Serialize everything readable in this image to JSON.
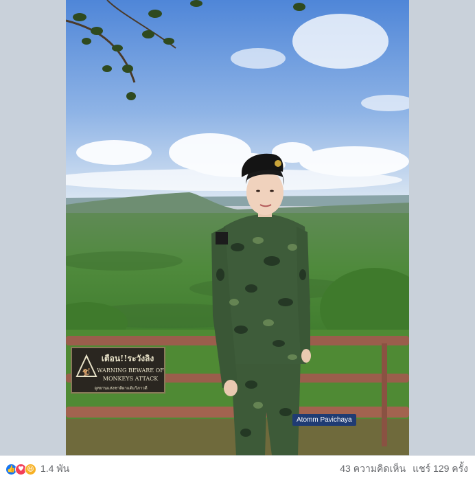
{
  "photo": {
    "sign_line1": "เตือน!!ระวังลิง",
    "sign_line2": "WARNING BEWARE OF",
    "sign_line3": "MONKEYS ATTACK",
    "sign_line4": "อุทยานแห่งชาติผาแต้มวิภาวดี",
    "credit_tag": "Atomm Pavichaya"
  },
  "footer": {
    "reaction_icons": [
      "like-icon",
      "love-icon",
      "haha-icon"
    ],
    "reaction_count": "1.4 พัน",
    "comments": "43 ความคิดเห็น",
    "shares": "แชร์ 129 ครั้ง"
  },
  "colors": {
    "like": "#1877f2",
    "love": "#f33e58",
    "haha": "#f7b125",
    "meta_text": "#65676b"
  }
}
